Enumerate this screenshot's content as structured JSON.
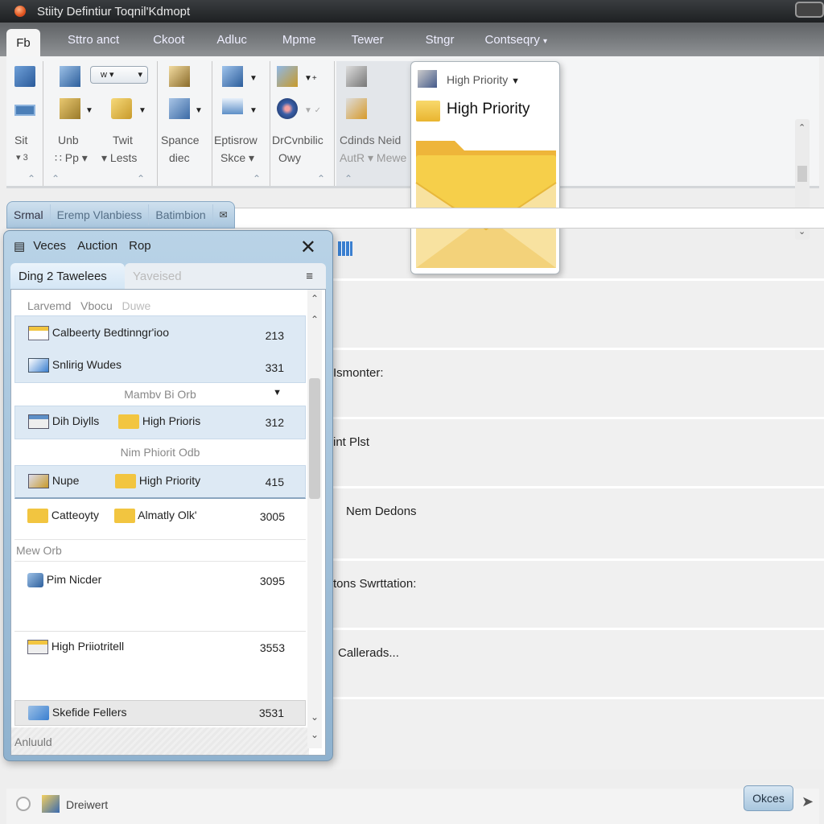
{
  "window": {
    "title": "Stiity Defintiur Toqnil'Kdmopt"
  },
  "menu": {
    "tabs": [
      "Fb",
      "Sttro anct",
      "Ckoot",
      "Adluc",
      "Mpme",
      "Tewer",
      "Stngr",
      "Contseqry"
    ]
  },
  "ribbon": {
    "groups": [
      {
        "label1": "Sit",
        "label2": "▾ 3"
      },
      {
        "label1": "Unb",
        "label2": "∷ Pp ▾",
        "label3": "Twit",
        "label4": "▾ Lests",
        "dropdown_value": "w"
      },
      {
        "label1": "Spance",
        "label2": "diec"
      },
      {
        "label1": "Eptisrow",
        "label2": "Skce ▾"
      },
      {
        "label1": "DrCvnbilic",
        "label2": "Owy"
      },
      {
        "label1": "Cdinds Neid",
        "label2": "AutR ▾ Mewe"
      }
    ]
  },
  "popup": {
    "dropdown_label": "High Priority",
    "item_label": "High Priority"
  },
  "secondary_tabs": [
    "Srmal",
    "Eremp Vlanbiess",
    "Batimbion"
  ],
  "main_rows": [
    "",
    "Ismonter:",
    "int Plst",
    "Nem Dedons",
    "tons Swrttation:",
    "Callerads...",
    ""
  ],
  "dialog": {
    "title_words": [
      "Veces",
      "Auction",
      "Rop"
    ],
    "tabs": [
      "Ding  2  Tawelees",
      "Yaveised"
    ],
    "column_headers": [
      "Larvemd",
      "Vbocu",
      "Duwe"
    ],
    "rows": [
      {
        "name": "Calbeerty Bedtinngr'ioo",
        "count": "213"
      },
      {
        "name": "Snlirig Wudes",
        "count": "331"
      },
      {
        "group": "Mambv Bi Orb"
      },
      {
        "name": "Dih Diylls",
        "tag": "High Prioris",
        "count": "312"
      },
      {
        "group": "Nim Phiorit Odb"
      },
      {
        "name": "Nupe",
        "tag": "High Priority",
        "count": "415"
      },
      {
        "name": "Catteoyty",
        "tag": "Almatly Olk'",
        "count": "3005"
      },
      {
        "group": "Mew Orb"
      },
      {
        "name": "Pim Nicder",
        "count": "3095"
      },
      {
        "name": "High Priiotritell",
        "count": "3553"
      },
      {
        "name": "Skefide Fellers",
        "count": "3531"
      }
    ],
    "footer": "Anluuld"
  },
  "status": {
    "text": "Dreiwert"
  },
  "ok_button": "Okces",
  "colors": {
    "accent_blue": "#a8c6de",
    "folder_yellow": "#f2c540",
    "titlebar": "#2a2c2e"
  }
}
